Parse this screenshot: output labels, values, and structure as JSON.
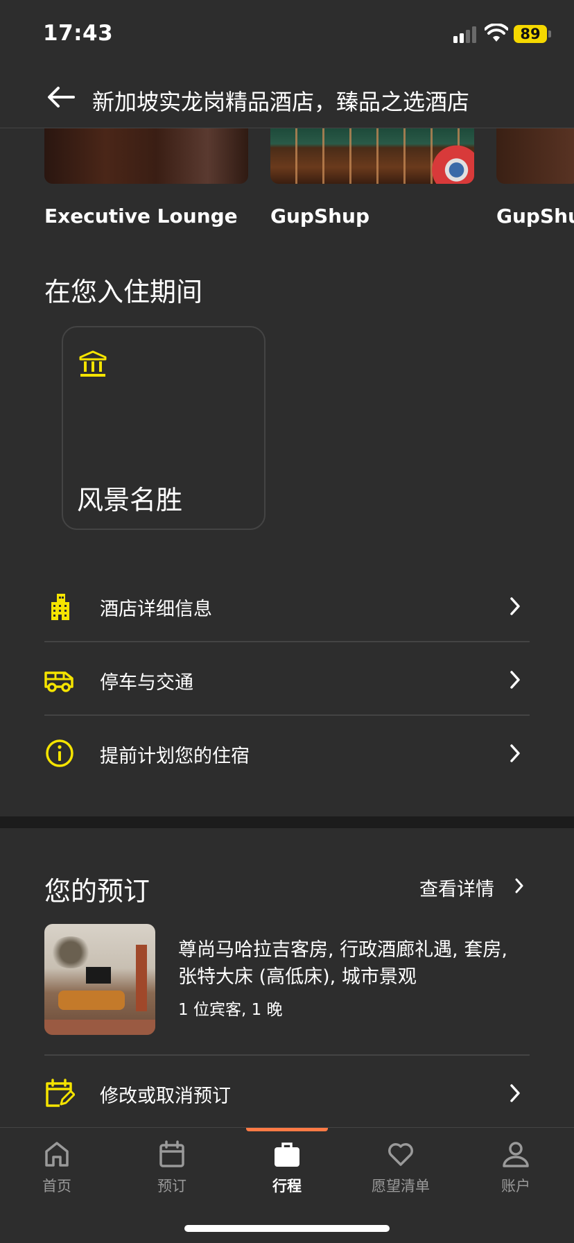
{
  "status_bar": {
    "time": "17:43",
    "battery": "89"
  },
  "header": {
    "title": "新加坡实龙岗精品酒店，臻品之选酒店",
    "back_icon": "arrow-left-icon"
  },
  "photos": [
    {
      "label": "Executive Lounge"
    },
    {
      "label": "GupShup"
    },
    {
      "label": "GupShu"
    }
  ],
  "during_stay": {
    "title": "在您入住期间",
    "card": {
      "label": "风景名胜",
      "icon": "museum-icon"
    }
  },
  "info_rows": [
    {
      "label": "酒店详细信息",
      "icon": "building-icon"
    },
    {
      "label": "停车与交通",
      "icon": "van-icon"
    },
    {
      "label": "提前计划您的住宿",
      "icon": "info-icon"
    }
  ],
  "reservation": {
    "title": "您的预订",
    "details_link": "查看详情",
    "room_name": "尊尚马哈拉吉客房, 行政酒廊礼遇, 套房, 张特大床 (高低床), 城市景观",
    "guests": "1 位宾客, 1 晚",
    "modify_label": "修改或取消预订",
    "modify_icon": "calendar-edit-icon"
  },
  "tab_bar": {
    "active": "行程",
    "accent_color": "#ff7a45",
    "tabs": [
      {
        "label": "首页",
        "icon": "home-icon"
      },
      {
        "label": "预订",
        "icon": "calendar-icon"
      },
      {
        "label": "行程",
        "icon": "briefcase-icon"
      },
      {
        "label": "愿望清单",
        "icon": "heart-icon"
      },
      {
        "label": "账户",
        "icon": "user-icon"
      }
    ]
  },
  "colors": {
    "background": "#2d2d2d",
    "icon_accent": "#f5e400",
    "text": "#ffffff"
  }
}
